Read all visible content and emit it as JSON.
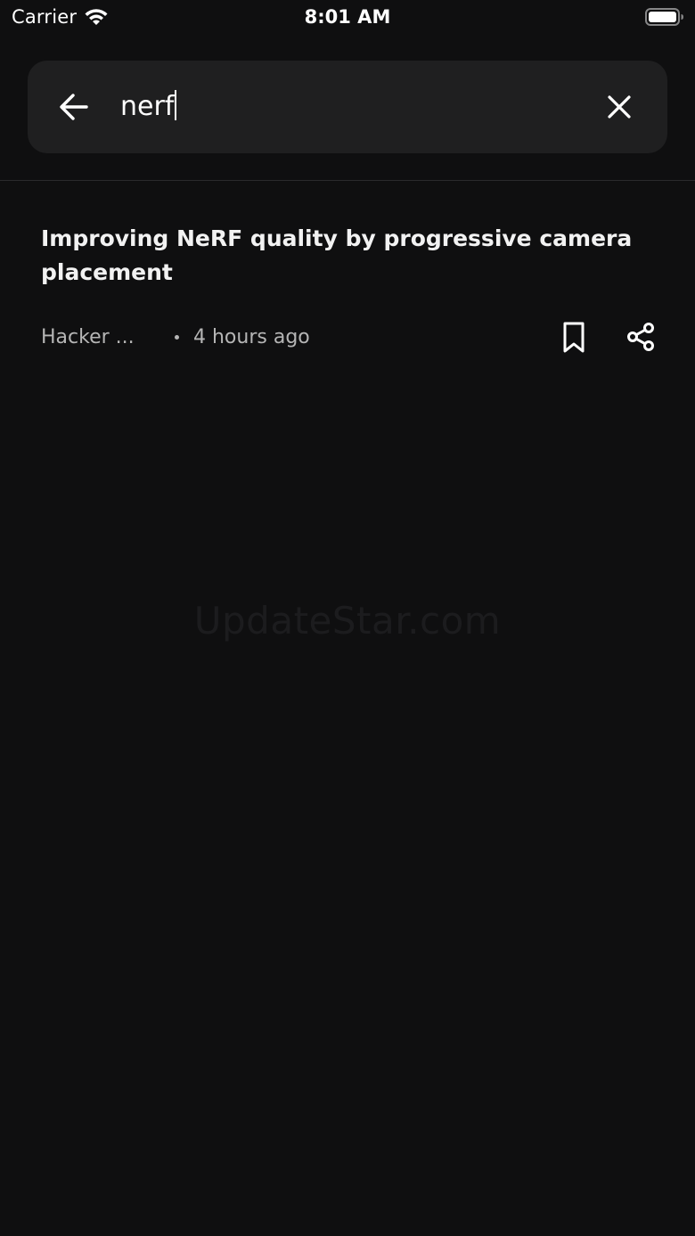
{
  "status_bar": {
    "carrier": "Carrier",
    "time": "8:01 AM",
    "wifi_icon": "wifi-icon",
    "battery_icon": "battery-icon"
  },
  "search": {
    "query": "nerf",
    "back_icon": "arrow-left-icon",
    "clear_icon": "close-icon"
  },
  "results": [
    {
      "title": "Improving NeRF quality by progressive camera placement",
      "source": "Hacker ...",
      "age": "4 hours ago",
      "bookmark_icon": "bookmark-icon",
      "share_icon": "share-icon"
    }
  ],
  "watermark": "UpdateStar.com",
  "colors": {
    "background": "#0f0f10",
    "search_bg": "#1f1f20",
    "text_primary": "#f2f2f2",
    "text_secondary": "#b5b5b5"
  }
}
